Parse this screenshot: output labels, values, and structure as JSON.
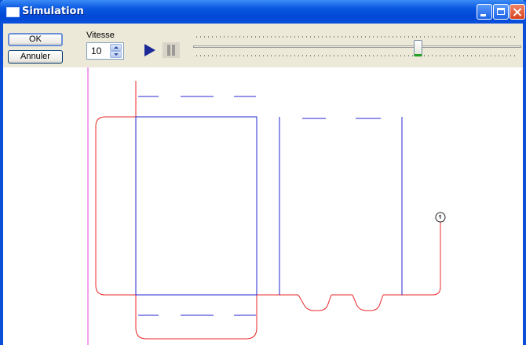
{
  "window": {
    "title": "Simulation"
  },
  "toolbar": {
    "ok_label": "OK",
    "cancel_label": "Annuler",
    "speed_label": "Vitesse",
    "speed_value": "10",
    "slider_position": 0.69
  },
  "colors": {
    "titlebar": "#0a58e0",
    "toolbar_background": "#ece9d8",
    "cut_line": "#e8282a",
    "fold_line": "#2424d2",
    "axis_line": "#e040e0",
    "play_icon": "#1c2a98"
  },
  "icons": {
    "play": "play-icon",
    "pause": "pause-icon",
    "minimize": "minimize-icon",
    "maximize": "maximize-icon",
    "close": "close-icon",
    "app": "window-icon",
    "start_marker": "circle-marker-icon"
  }
}
